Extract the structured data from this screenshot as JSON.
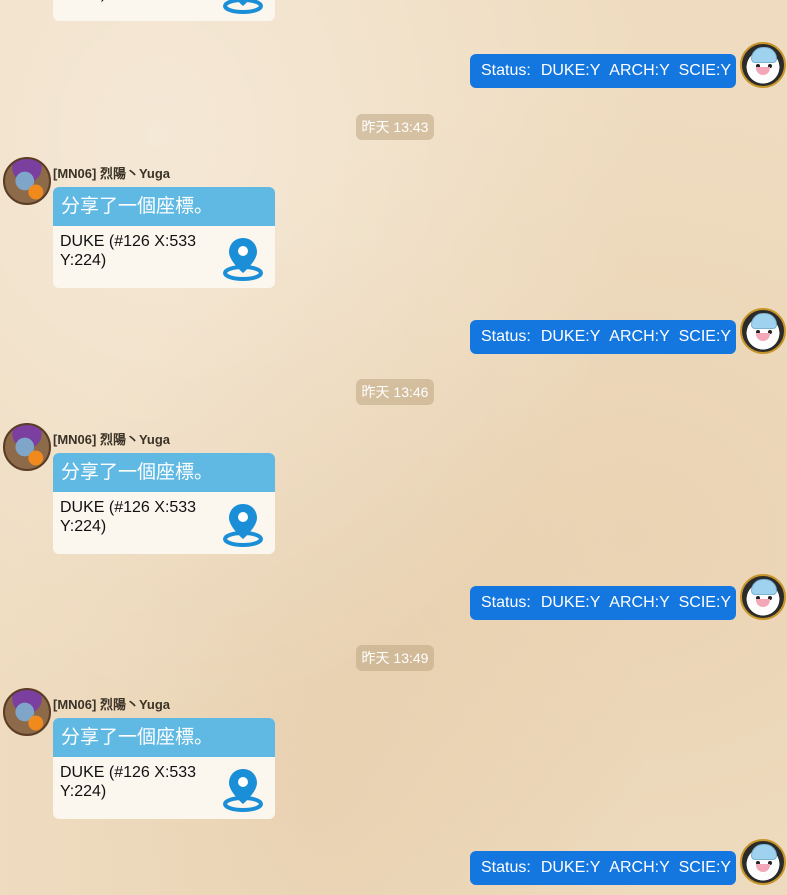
{
  "status_label": "Status:",
  "status_duke": "DUKE:Y",
  "status_arch": "ARCH:Y",
  "status_scie": "SCIE:Y",
  "times": [
    "昨天 13:43",
    "昨天 13:46",
    "昨天 13:49"
  ],
  "sender_name": "[MN06] 烈陽丶Yuga",
  "location_share": {
    "header": "分享了一個座標。",
    "coords": "DUKE (#126 X:533 Y:224)"
  },
  "colors": {
    "status_bubble": "#1477e0",
    "location_header": "#5fb9e3",
    "pin": "#1a8fd8"
  },
  "icons": {
    "location_pin": "map-pin-icon"
  }
}
